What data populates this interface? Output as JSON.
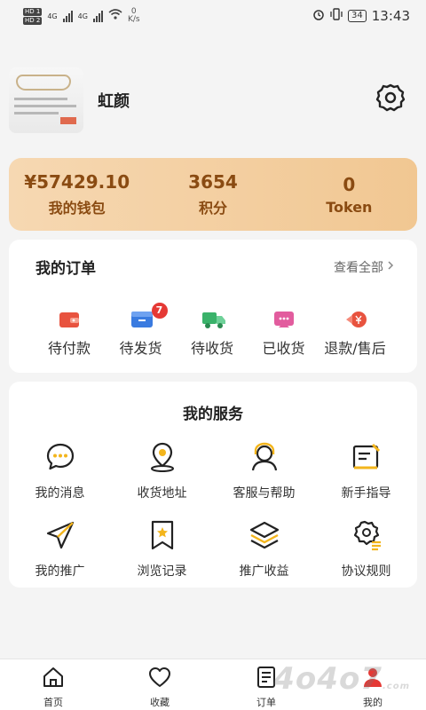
{
  "status_bar": {
    "hd1": "HD 1",
    "hd2": "HD 2",
    "net1": "4G",
    "net2": "4G",
    "speed_value": "0",
    "speed_unit": "K/s",
    "battery": "34",
    "time": "13:43"
  },
  "profile": {
    "nickname": "虹颜"
  },
  "wallet": {
    "balance": "¥57429.10",
    "balance_label": "我的钱包",
    "points": "3654",
    "points_label": "积分",
    "token": "0",
    "token_label": "Token"
  },
  "orders": {
    "title": "我的订单",
    "see_all": "查看全部",
    "items": [
      {
        "label": "待付款",
        "icon": "wallet-icon",
        "color": "#e8533f"
      },
      {
        "label": "待发货",
        "icon": "box-icon",
        "color": "#3a7be0",
        "badge": "7"
      },
      {
        "label": "待收货",
        "icon": "truck-icon",
        "color": "#3ab26a"
      },
      {
        "label": "已收货",
        "icon": "received-icon",
        "color": "#e25c9e"
      },
      {
        "label": "退款/售后",
        "icon": "refund-icon",
        "color": "#e8533f"
      }
    ]
  },
  "services": {
    "title": "我的服务",
    "items": [
      {
        "label": "我的消息",
        "icon": "message-icon"
      },
      {
        "label": "收货地址",
        "icon": "location-icon"
      },
      {
        "label": "客服与帮助",
        "icon": "support-icon"
      },
      {
        "label": "新手指导",
        "icon": "guide-icon"
      },
      {
        "label": "我的推广",
        "icon": "send-icon"
      },
      {
        "label": "浏览记录",
        "icon": "bookmark-icon"
      },
      {
        "label": "推广收益",
        "icon": "layers-icon"
      },
      {
        "label": "协议规则",
        "icon": "rules-icon"
      }
    ]
  },
  "bottom_nav": {
    "items": [
      {
        "label": "首页",
        "icon": "home-icon"
      },
      {
        "label": "收藏",
        "icon": "heart-icon"
      },
      {
        "label": "订单",
        "icon": "order-icon"
      },
      {
        "label": "我的",
        "icon": "profile-icon",
        "active": true
      }
    ]
  },
  "watermark": {
    "text": "4o4o7",
    "suffix": ".com"
  },
  "colors": {
    "accent": "#f3b51c",
    "wallet_text": "#8a4b12",
    "wallet_bg": "#f1c792"
  }
}
